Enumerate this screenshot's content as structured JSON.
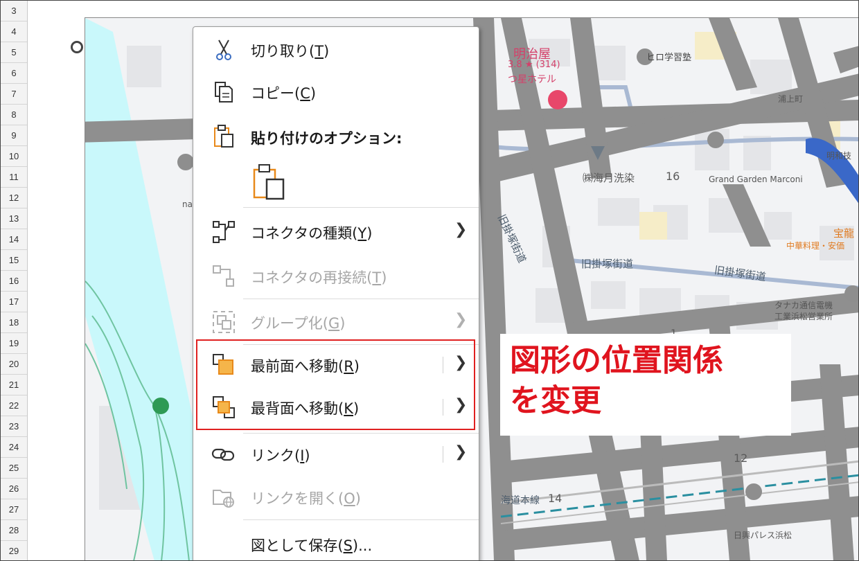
{
  "rows": [
    "3",
    "4",
    "5",
    "6",
    "7",
    "8",
    "9",
    "10",
    "11",
    "12",
    "13",
    "14",
    "15",
    "16",
    "17",
    "18",
    "19",
    "20",
    "21",
    "22",
    "23",
    "24",
    "25",
    "26",
    "27",
    "28",
    "29"
  ],
  "map": {
    "labels": {
      "meijiya": "明治屋",
      "rating": "3.8 ★ (314)",
      "hotel": "つ星ホテル",
      "hiro": "ヒロ学習塾",
      "shrine": "浦上町",
      "wako": "明和技",
      "umitsuki": "㈱海月洗染",
      "num16": "16",
      "grand": "Grand Garden Marconi",
      "kyukake1": "旧掛塚街道",
      "kyukake2": "旧掛塚街道",
      "kyukake3": "旧掛塚街道",
      "takara": "宝龍",
      "chuka": "中華料理・安価",
      "tanaka1": "タナカ通信電機",
      "tanaka2": "工業浜松営業所",
      "num1": "1",
      "num12": "12",
      "tokaido": "海道本線",
      "num14": "14",
      "nichiei": "日興パレス浜松",
      "nai": "nai"
    }
  },
  "menu": {
    "cut": {
      "label": "切り取り(",
      "key": "T",
      "end": ")"
    },
    "copy": {
      "label": "コピー(",
      "key": "C",
      "end": ")"
    },
    "paste_options": {
      "label": "貼り付けのオプション:"
    },
    "connector_type": {
      "label": "コネクタの種類(",
      "key": "Y",
      "end": ")"
    },
    "reconnect": {
      "label": "コネクタの再接続(",
      "key": "T",
      "end": ")"
    },
    "group": {
      "label": "グループ化(",
      "key": "G",
      "end": ")"
    },
    "bring_front": {
      "label": "最前面へ移動(",
      "key": "R",
      "end": ")"
    },
    "send_back": {
      "label": "最背面へ移動(",
      "key": "K",
      "end": ")"
    },
    "link": {
      "label": "リンク(",
      "key": "I",
      "end": ")"
    },
    "open_link": {
      "label": "リンクを開く(",
      "key": "O",
      "end": ")"
    },
    "save_as_picture": {
      "label": "図として保存(",
      "key": "S",
      "end": ")..."
    }
  },
  "callout": {
    "line1": "図形の位置関係",
    "line2": "を変更"
  },
  "colors": {
    "accent": "#e0141e",
    "icon_orange": "#e8891a",
    "road": "#909090",
    "river": "#c9f8fb"
  }
}
